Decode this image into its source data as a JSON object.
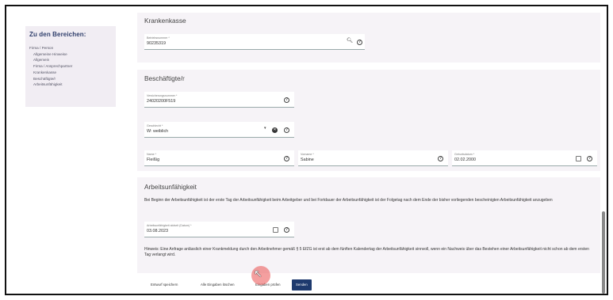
{
  "sidebar": {
    "title": "Zu den Bereichen:",
    "items": [
      {
        "label": "Firma / Person",
        "level": 1
      },
      {
        "label": "Allgemeine Hinweise",
        "level": 2
      },
      {
        "label": "Allgemein",
        "level": 2
      },
      {
        "label": "Firma / Ansprechpartner",
        "level": 2
      },
      {
        "label": "Krankenkasse",
        "level": 2
      },
      {
        "label": "Beschäftigte/r",
        "level": 2
      },
      {
        "label": "Arbeitsunfähigkeit",
        "level": 2
      }
    ]
  },
  "krankenkasse": {
    "title": "Krankenkasse",
    "betriebsnummer": {
      "label": "Betriebsnummer *",
      "value": "90235319"
    }
  },
  "beschaeftigte": {
    "title": "Beschäftigte/r",
    "versicherungsnummer": {
      "label": "Versicherungsnummer *",
      "value": "24020200F519"
    },
    "geschlecht": {
      "label": "Geschlecht *",
      "value": "W: weiblich"
    },
    "name": {
      "label": "Name *",
      "value": "Fleißig"
    },
    "vorname": {
      "label": "Vorname *",
      "value": "Sabine"
    },
    "geburtsdatum": {
      "label": "Geburtsdatum *",
      "value": "02.02.2000"
    }
  },
  "arbeitsunfaehigkeit": {
    "title": "Arbeitsunfähigkeit",
    "intro": "Bei Beginn der Arbeitsunfähigkeit ist der erste Tag der Arbeitsunfähigkeit beim Arbeitgeber und bei Fortdauer der Arbeitsunfähigkeit ist der Folgetag nach dem Ende der bisher vorliegenden bescheinigten Arbeitsunfähigkeit anzugeben",
    "datum": {
      "label": "Arbeitsunfähigkeit ab/seit (Datum) *",
      "value": "03.08.2023"
    },
    "hinweis": "Hinweis: Eine Anfrage anlässlich einer Krankmeldung durch den Arbeitnehmer gemäß § 5 EfZG ist erst ab dem fünften Kalendertag der Arbeitsunfähigkeit sinnvoll, wenn ein Nachweis über das Bestehen einer Arbeitsunfähigkeit nicht schon ab dem ersten Tag verlangt wird."
  },
  "actions": {
    "save_draft": "Entwurf speichern",
    "clear_all": "Alle Eingaben löschen",
    "check": "Eingaben prüfen",
    "send": "Senden"
  },
  "icons": {
    "search": "search-icon",
    "help": "help-icon",
    "clear": "clear-icon",
    "calendar": "calendar-icon",
    "dropdown": "dropdown-arrow-icon"
  },
  "colors": {
    "sidebar_title": "#2f3e6b",
    "primary_button": "#1e3a6e",
    "section_bg": "#f6f3f7"
  }
}
